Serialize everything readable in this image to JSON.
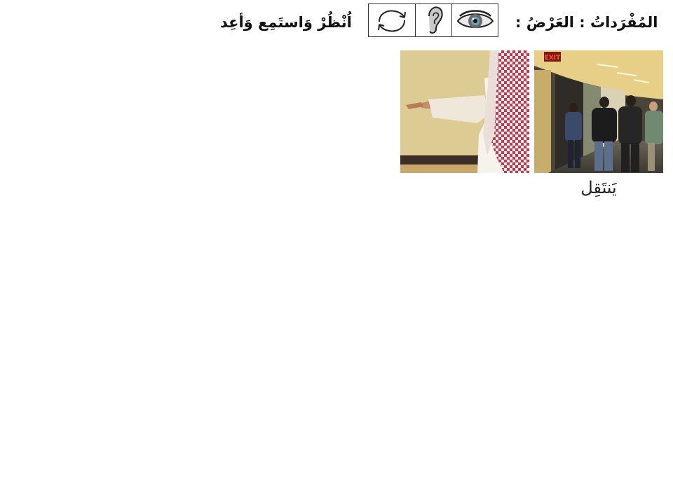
{
  "header": {
    "title": "المُفْرَداتُ : العَرْضُ :",
    "instruction": "اُنْظُرْ وَاستَمِع وَأعِد"
  },
  "icons": [
    "repeat-arrows-icon",
    "ear-icon",
    "eye-icon"
  ],
  "photos": {
    "hallway": {
      "sign": "EXIT",
      "caption": "يَنتَقِل"
    }
  },
  "colors": {
    "text": "#111111",
    "border": "#333333",
    "keffiyeh_red": "#c8374a"
  }
}
